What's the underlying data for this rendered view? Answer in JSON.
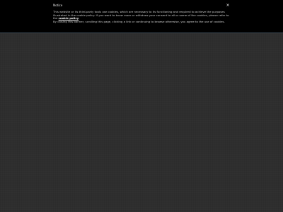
{
  "notice": {
    "title": "Notice",
    "close_label": "×",
    "line1": "This website or its third-party tools use cookies, which are necessary to its functioning and required to achieve the purposes",
    "line2": "illustrated in the cookie policy. If you want to know more or withdraw your consent to all or some of the cookies, please refer to",
    "line3_prefix": "the ",
    "cookie_policy_link": "cookie policy",
    "line3_suffix": ".",
    "line4": "By closing this banner, scrolling this page, clicking a link or continuing to browse otherwise, you agree to the use of cookies."
  },
  "colors": {
    "banner_bg": "#000000",
    "page_bg": "#2e2e2e",
    "banner_border": "#3c4a55"
  }
}
